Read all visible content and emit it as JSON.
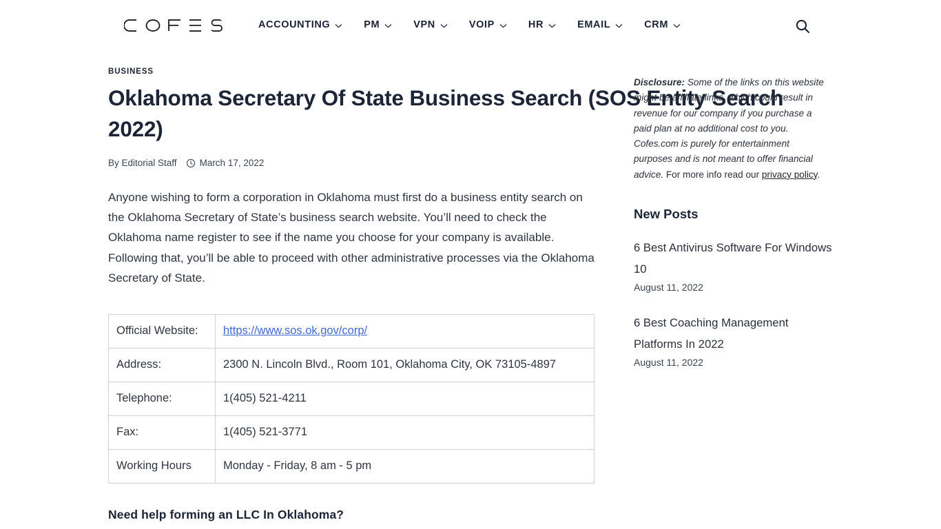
{
  "header": {
    "logo_text": "COFES",
    "nav": [
      {
        "label": "ACCOUNTING",
        "has_dropdown": true
      },
      {
        "label": "PM",
        "has_dropdown": true
      },
      {
        "label": "VPN",
        "has_dropdown": true
      },
      {
        "label": "VOIP",
        "has_dropdown": true
      },
      {
        "label": "HR",
        "has_dropdown": true
      },
      {
        "label": "EMAIL",
        "has_dropdown": true
      },
      {
        "label": "CRM",
        "has_dropdown": true
      }
    ],
    "search_icon": "search-icon"
  },
  "article": {
    "category": "BUSINESS",
    "title": "Oklahoma Secretary Of State Business Search (SOS Entity Search 2022)",
    "byline_author": "By Editorial Staff",
    "byline_date": "March 17, 2022",
    "byline_icon": "clock-icon",
    "intro_paragraph": "Anyone wishing to form a corporation in Oklahoma must first do a business entity search on the Oklahoma Secretary of State’s business search website. You’ll need to check the Oklahoma name register to see if the name you choose for your company is available. Following that, you’ll be able to proceed with other administrative processes via the Oklahoma Secretary of State.",
    "table": [
      {
        "label": "Official Website:",
        "value": "https://www.sos.ok.gov/corp/",
        "is_link": true
      },
      {
        "label": "Address:",
        "value": "2300 N. Lincoln Blvd., Room 101, Oklahoma City, OK 73105-4897",
        "is_link": false
      },
      {
        "label": "Telephone:",
        "value": "1(405) 521-4211",
        "is_link": false
      },
      {
        "label": "Fax:",
        "value": "1(405) 521-3771",
        "is_link": false
      },
      {
        "label": "Working Hours",
        "value": "Monday -  Friday, 8 am -  5 pm",
        "is_link": false
      }
    ],
    "section_heading": "Need help forming an LLC In Oklahoma?"
  },
  "sidebar": {
    "disclosure": {
      "lead": "Disclosure:",
      "italic_body": " Some of the links on this website might be affiliate links, which could result in revenue for our company if you purchase a paid plan at no additional cost to you. Cofes.com is purely for entertainment purposes and is not meant to offer financial advice.",
      "tail_before_link": " For more info read our ",
      "link_text": "privacy policy",
      "tail_after_link": "."
    },
    "new_posts_heading": "New Posts",
    "posts": [
      {
        "title": "6 Best Antivirus Software For Windows 10",
        "date": "August 11, 2022"
      },
      {
        "title": "6 Best Coaching Management Platforms In 2022",
        "date": "August 11, 2022"
      }
    ]
  },
  "colors": {
    "text_dark": "#1b2536",
    "body_text": "#2f3540",
    "link_blue": "#4169d8",
    "table_border": "#cfd2d6",
    "background": "#ffffff"
  }
}
